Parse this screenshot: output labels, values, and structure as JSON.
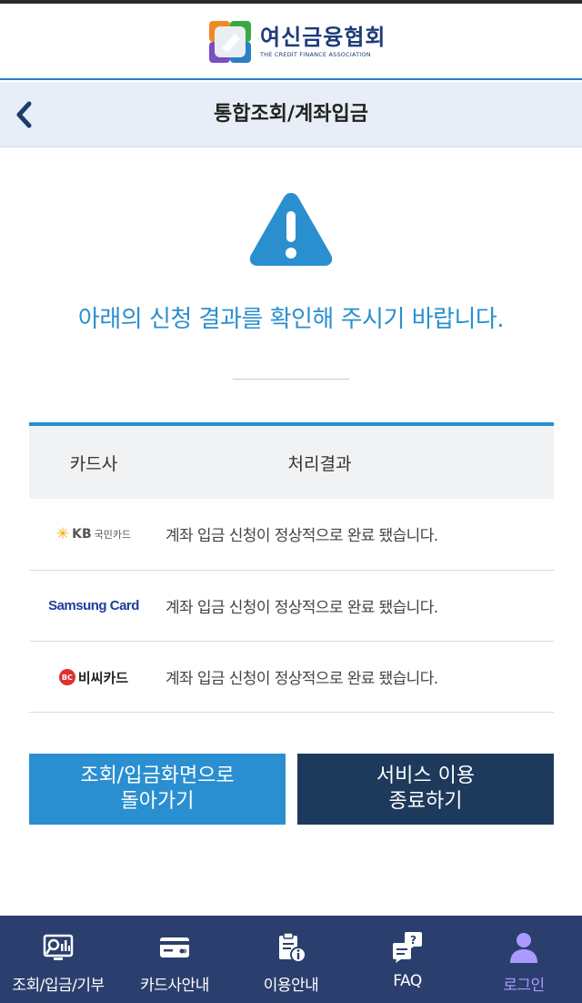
{
  "header": {
    "brand_name": "여신금융협회",
    "brand_sub": "THE CREDIT FINANCE ASSOCIATION"
  },
  "title_bar": {
    "title": "통합조회/계좌입금"
  },
  "notice": {
    "message": "아래의 신청 결과를 확인해 주시기 바랍니다."
  },
  "table": {
    "headers": [
      "카드사",
      "처리결과"
    ],
    "rows": [
      {
        "company": "KB국민카드",
        "logo_text": "KB",
        "logo_sub": "국민카드",
        "result": "계좌 입금 신청이 정상적으로 완료 됐습니다."
      },
      {
        "company": "Samsung Card",
        "logo_text": "Samsung Card",
        "result": "계좌 입금 신청이 정상적으로 완료 됐습니다."
      },
      {
        "company": "비씨카드",
        "logo_text": "비씨카드",
        "logo_mark": "BC",
        "result": "계좌 입금 신청이 정상적으로 완료 됐습니다."
      }
    ]
  },
  "buttons": {
    "back_line1": "조회/입금화면으로",
    "back_line2": "돌아가기",
    "exit_line1": "서비스 이용",
    "exit_line2": "종료하기"
  },
  "bottom_nav": {
    "items": [
      {
        "label": "조회/입금/기부",
        "icon": "search-chart-icon"
      },
      {
        "label": "카드사안내",
        "icon": "card-icon"
      },
      {
        "label": "이용안내",
        "icon": "clipboard-info-icon"
      },
      {
        "label": "FAQ",
        "icon": "faq-chat-icon"
      },
      {
        "label": "로그인",
        "icon": "user-icon",
        "active": true
      }
    ]
  },
  "colors": {
    "accent": "#2a8fce",
    "nav_bg": "#2b3f6e",
    "exit_button": "#1d3a5c",
    "active_nav": "#a99bff"
  }
}
